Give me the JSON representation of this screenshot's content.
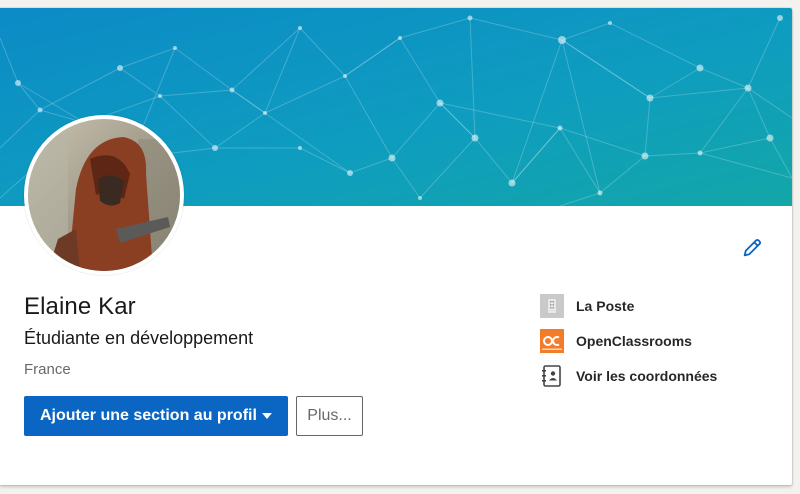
{
  "profile": {
    "name": "Elaine Kar",
    "headline": "Étudiante en développement",
    "location": "France"
  },
  "actions": {
    "add_section_label": "Ajouter une section au profil",
    "more_label": "Plus..."
  },
  "side_links": [
    {
      "label": "La Poste",
      "icon": "company-building-icon"
    },
    {
      "label": "OpenClassrooms",
      "icon": "openclassrooms-logo-icon"
    },
    {
      "label": "Voir les coordonnées",
      "icon": "contact-book-icon"
    }
  ],
  "colors": {
    "primary": "#0a66c2",
    "banner_start": "#0f8ec7",
    "banner_end": "#13a6a8",
    "oc_orange": "#f47b27"
  }
}
